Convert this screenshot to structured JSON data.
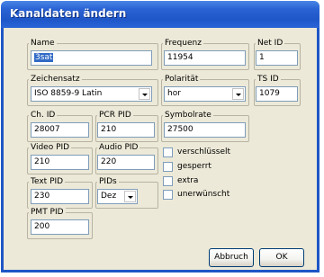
{
  "window": {
    "title": "Kanaldaten ändern"
  },
  "fields": {
    "name": {
      "label": "Name",
      "value": "3sat"
    },
    "frequenz": {
      "label": "Frequenz",
      "value": "11954"
    },
    "net_id": {
      "label": "Net ID",
      "value": "1"
    },
    "zeichensatz": {
      "label": "Zeichensatz",
      "value": "ISO 8859-9 Latin"
    },
    "polaritaet": {
      "label": "Polarität",
      "value": "hor"
    },
    "ts_id": {
      "label": "TS ID",
      "value": "1079"
    },
    "ch_id": {
      "label": "Ch. ID",
      "value": "28007"
    },
    "pcr_pid": {
      "label": "PCR PID",
      "value": "210"
    },
    "symbolrate": {
      "label": "Symbolrate",
      "value": "27500"
    },
    "video_pid": {
      "label": "Video PID",
      "value": "210"
    },
    "audio_pid": {
      "label": "Audio PID",
      "value": "220"
    },
    "text_pid": {
      "label": "Text PID",
      "value": "230"
    },
    "pids": {
      "label": "PIDs",
      "value": "Dez"
    },
    "pmt_pid": {
      "label": "PMT PID",
      "value": "200"
    }
  },
  "checkboxes": [
    {
      "label": "verschlüsselt",
      "checked": false
    },
    {
      "label": "gesperrt",
      "checked": false
    },
    {
      "label": "extra",
      "checked": false
    },
    {
      "label": "unerwünscht",
      "checked": false
    }
  ],
  "buttons": {
    "cancel": "Abbruch",
    "ok": "OK"
  }
}
